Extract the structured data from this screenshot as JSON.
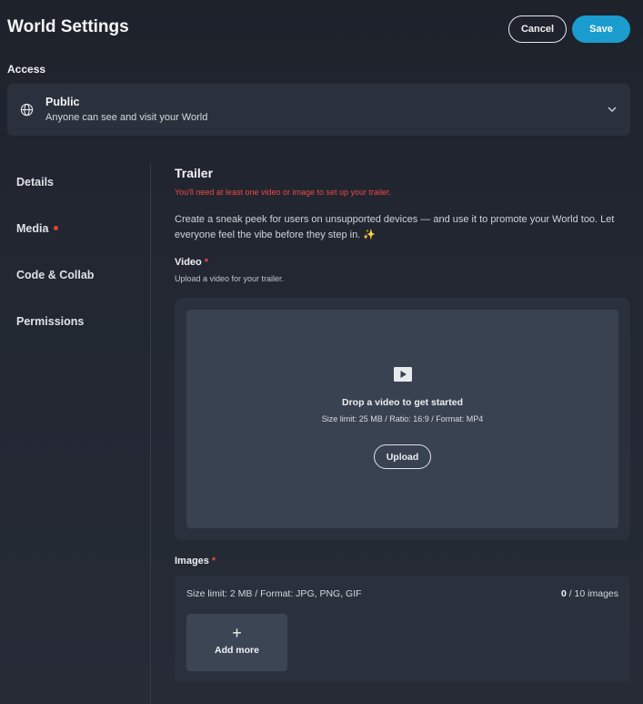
{
  "header": {
    "title": "World Settings",
    "cancel_label": "Cancel",
    "save_label": "Save"
  },
  "access": {
    "label": "Access",
    "selected": "Public",
    "description": "Anyone can see and visit your World",
    "icon": "globe-icon"
  },
  "nav": {
    "items": [
      {
        "label": "Details",
        "has_alert": false
      },
      {
        "label": "Media",
        "has_alert": true
      },
      {
        "label": "Code & Collab",
        "has_alert": false
      },
      {
        "label": "Permissions",
        "has_alert": false
      }
    ]
  },
  "trailer": {
    "title": "Trailer",
    "error": "You'll need at least one video or image to set up your trailer.",
    "description": "Create a sneak peek for users on unsupported devices — and use it to promote your World too. Let everyone feel the vibe before they step in. ✨",
    "video": {
      "label": "Video",
      "required_mark": "*",
      "hint": "Upload a video for your trailer.",
      "drop_title": "Drop a video to get started",
      "drop_meta": "Size limit: 25 MB / Ratio: 16:9 / Format: MP4",
      "upload_label": "Upload"
    },
    "images": {
      "label": "Images",
      "required_mark": "*",
      "limit": "Size limit: 2 MB / Format: JPG, PNG, GIF",
      "count": "0",
      "count_suffix": "/ 10 images",
      "add_more_label": "Add more"
    }
  },
  "colors": {
    "accent": "#1a9ccf",
    "error": "#ea4a47",
    "panel": "#2b313c",
    "dropzone": "#394250"
  }
}
